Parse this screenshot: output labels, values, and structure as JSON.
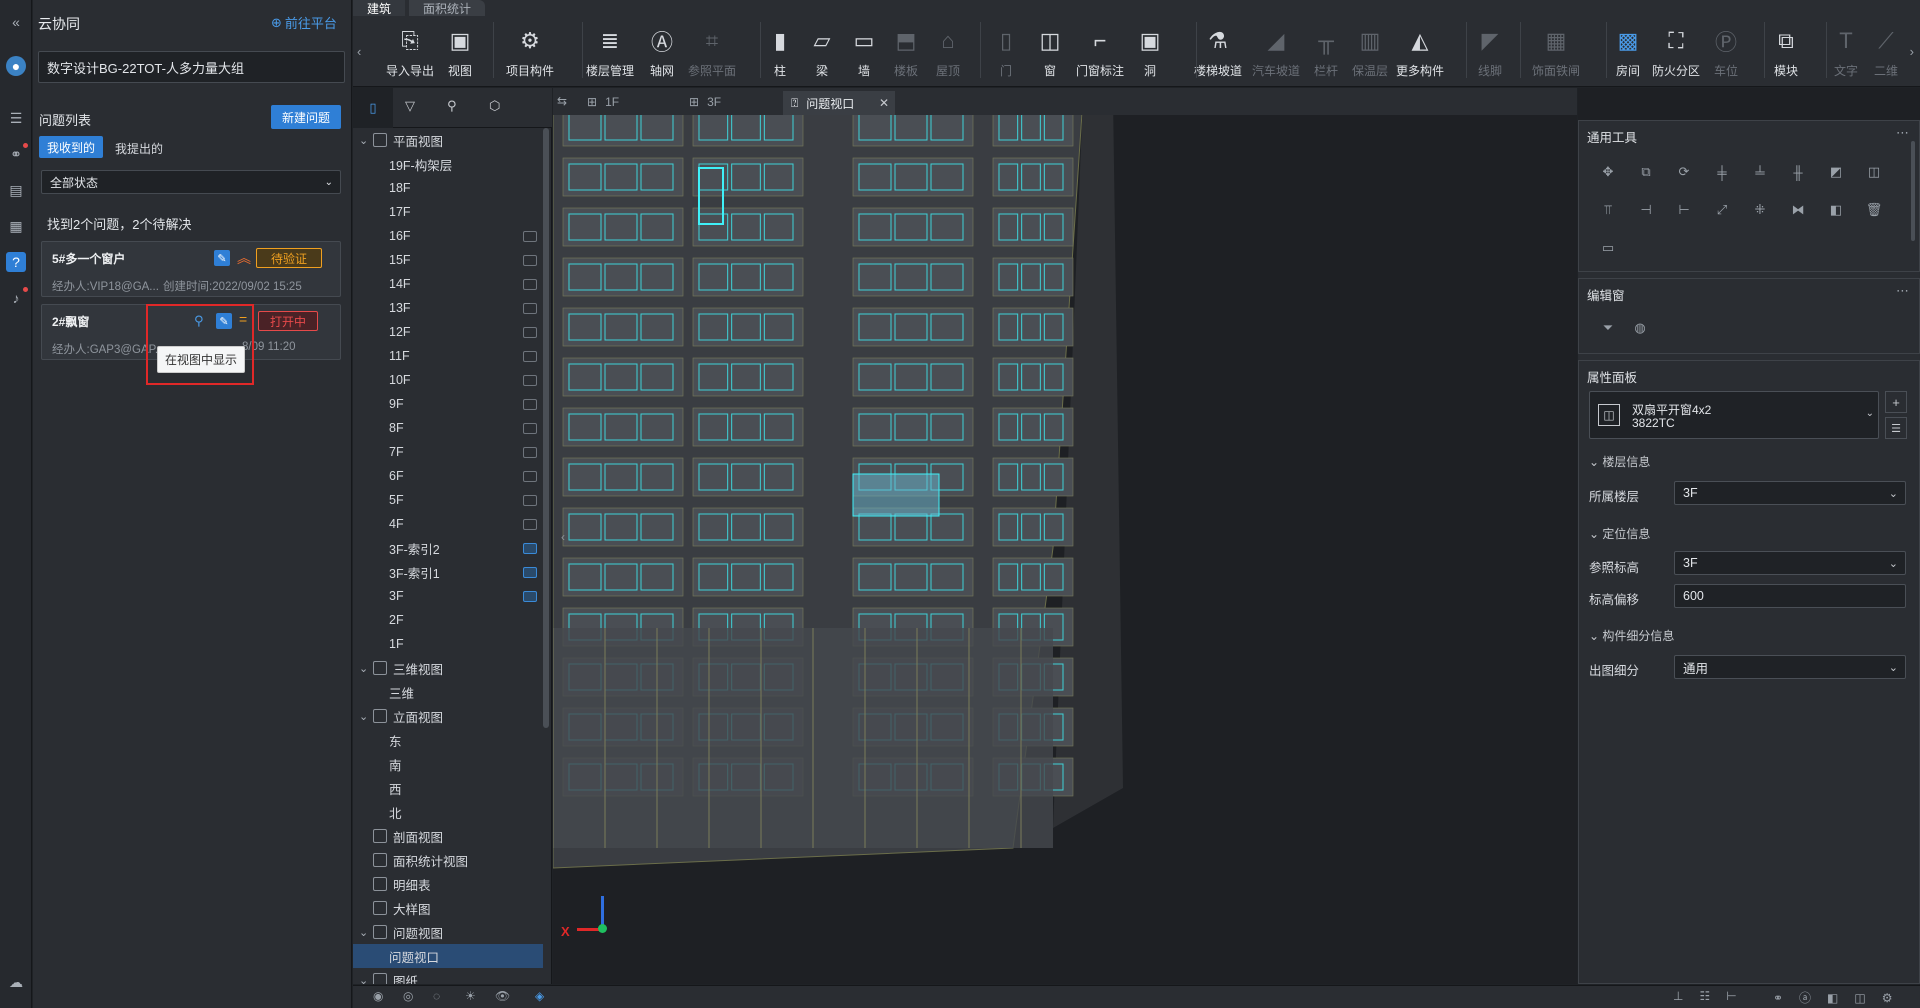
{
  "app": {
    "title": "云协同",
    "goto_platform": "前往平台"
  },
  "project": {
    "name": "数字设计BG-22TOT-人多力量大组"
  },
  "issues": {
    "heading": "问题列表",
    "new_button": "新建问题",
    "tabs": [
      {
        "label": "我收到的",
        "active": true
      },
      {
        "label": "我提出的",
        "active": false
      }
    ],
    "status_filter": "全部状态",
    "summary": "找到2个问题，2个待解决",
    "items": [
      {
        "title": "5#多一个窗户",
        "status": "待验证",
        "status_color": "#f0a020",
        "handler": "经办人:VIP18@GA...",
        "created": "创建时间:2022/09/02 15:25"
      },
      {
        "title": "2#飘窗",
        "status": "打开中",
        "status_color": "#e64a4a",
        "handler": "经办人:GAP3@GAP...",
        "created": "8/09 11:20"
      }
    ],
    "tooltip": "在视图中显示"
  },
  "toolbar": {
    "tabs": [
      {
        "label": "建筑",
        "active": true
      },
      {
        "label": "面积统计",
        "active": false
      }
    ],
    "tools": [
      {
        "label": "导入导出",
        "icon": "cad-icon",
        "enabled": true
      },
      {
        "label": "视图",
        "icon": "view-icon",
        "enabled": true
      },
      {
        "label": "项目构件",
        "icon": "component-icon",
        "enabled": true
      },
      {
        "label": "楼层管理",
        "icon": "floor-manage-icon",
        "enabled": true
      },
      {
        "label": "轴网",
        "icon": "axis-icon",
        "enabled": true
      },
      {
        "label": "参照平面",
        "icon": "ref-plane-icon",
        "enabled": false
      },
      {
        "label": "柱",
        "icon": "column-icon",
        "enabled": true
      },
      {
        "label": "梁",
        "icon": "beam-icon",
        "enabled": true
      },
      {
        "label": "墙",
        "icon": "wall-icon",
        "enabled": true
      },
      {
        "label": "楼板",
        "icon": "slab-icon",
        "enabled": false
      },
      {
        "label": "屋顶",
        "icon": "roof-icon",
        "enabled": false
      },
      {
        "label": "门",
        "icon": "door-icon",
        "enabled": false
      },
      {
        "label": "窗",
        "icon": "window-icon",
        "enabled": true
      },
      {
        "label": "门窗标注",
        "icon": "door-window-tag-icon",
        "enabled": true
      },
      {
        "label": "洞",
        "icon": "opening-icon",
        "enabled": true
      },
      {
        "label": "楼梯坡道",
        "icon": "stair-icon",
        "enabled": true
      },
      {
        "label": "汽车坡道",
        "icon": "car-ramp-icon",
        "enabled": false
      },
      {
        "label": "栏杆",
        "icon": "railing-icon",
        "enabled": false
      },
      {
        "label": "保温层",
        "icon": "insulation-icon",
        "enabled": false
      },
      {
        "label": "更多构件",
        "icon": "more-components-icon",
        "enabled": true
      },
      {
        "label": "线脚",
        "icon": "molding-icon",
        "enabled": false
      },
      {
        "label": "饰面铁闸",
        "icon": "facade-icon",
        "enabled": false
      },
      {
        "label": "房间",
        "icon": "room-icon",
        "enabled": true
      },
      {
        "label": "防火分区",
        "icon": "fire-zone-icon",
        "enabled": true
      },
      {
        "label": "车位",
        "icon": "parking-icon",
        "enabled": false
      },
      {
        "label": "模块",
        "icon": "module-icon",
        "enabled": true
      },
      {
        "label": "文字",
        "icon": "text-icon",
        "enabled": false
      },
      {
        "label": "二维",
        "icon": "2d-line-icon",
        "enabled": false
      }
    ]
  },
  "view_tabs": [
    {
      "label": "1F",
      "active": false
    },
    {
      "label": "3F",
      "active": false
    },
    {
      "label": "问题视口",
      "active": true
    }
  ],
  "tree": {
    "plan": {
      "label": "平面视图",
      "floors": [
        "19F-构架层",
        "18F",
        "17F",
        "16F",
        "15F",
        "14F",
        "13F",
        "12F",
        "11F",
        "10F",
        "9F",
        "8F",
        "7F",
        "6F",
        "5F",
        "4F",
        "3F-索引2",
        "3F-索引1",
        "3F",
        "2F",
        "1F"
      ]
    },
    "three_d": {
      "label": "三维视图",
      "items": [
        "三维"
      ]
    },
    "elevation": {
      "label": "立面视图",
      "items": [
        "东",
        "南",
        "西",
        "北"
      ]
    },
    "others": [
      "剖面视图",
      "面积统计视图",
      "明细表",
      "大样图"
    ],
    "issue_view": {
      "label": "问题视图",
      "items": [
        "问题视口"
      ]
    },
    "cut": "图纸"
  },
  "right": {
    "tools_title": "通用工具",
    "edit_title": "编辑窗",
    "props_title": "属性面板",
    "component": {
      "name": "双扇平开窗4x2",
      "code": "3822TC"
    },
    "floor_info": "楼层信息",
    "floor_label": "所属楼层",
    "floor_value": "3F",
    "pos_info": "定位信息",
    "ref_label": "参照标高",
    "ref_value": "3F",
    "offset_label": "标高偏移",
    "offset_value": "600",
    "detail_info": "构件细分信息",
    "detail_label": "出图细分",
    "detail_value": "通用"
  },
  "axis": {
    "x": "X"
  }
}
